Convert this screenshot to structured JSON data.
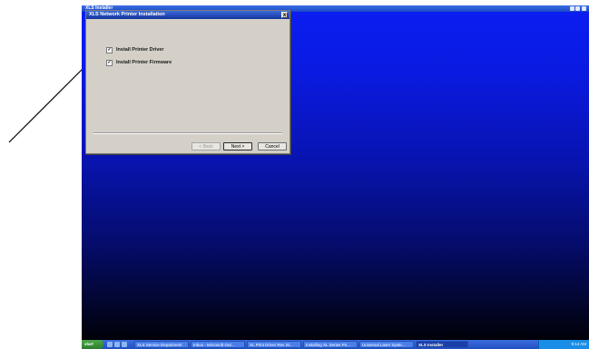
{
  "window": {
    "title": "XLS Installer"
  },
  "dialog": {
    "title": "XLS Network Printer Installation",
    "close_label": "x",
    "options": [
      {
        "label": "Install Printer Driver",
        "checked": true
      },
      {
        "label": "Install Printer Firmware",
        "checked": true
      }
    ],
    "buttons": {
      "back": "< Back",
      "next": "Next >",
      "cancel": "Cancel"
    }
  },
  "taskbar": {
    "start_label": "start",
    "tasks": [
      {
        "label": "XLS Service Department",
        "active": false
      },
      {
        "label": "Inbox - Microsoft Out...",
        "active": false
      },
      {
        "label": "XL Print Driver Rev St...",
        "active": false
      },
      {
        "label": "Installing XL Series Pri...",
        "active": false
      },
      {
        "label": "Universal Laser Syste...",
        "active": false
      },
      {
        "label": "XLS Installer",
        "active": true
      }
    ],
    "clock": "9:14 AM"
  },
  "colors": {
    "desktop_top": "#0b1ef2",
    "desktop_bottom": "#000000",
    "dialog_bg": "#d4d0c8",
    "titlebar": "#14349e",
    "taskbar": "#1f4fc0"
  }
}
